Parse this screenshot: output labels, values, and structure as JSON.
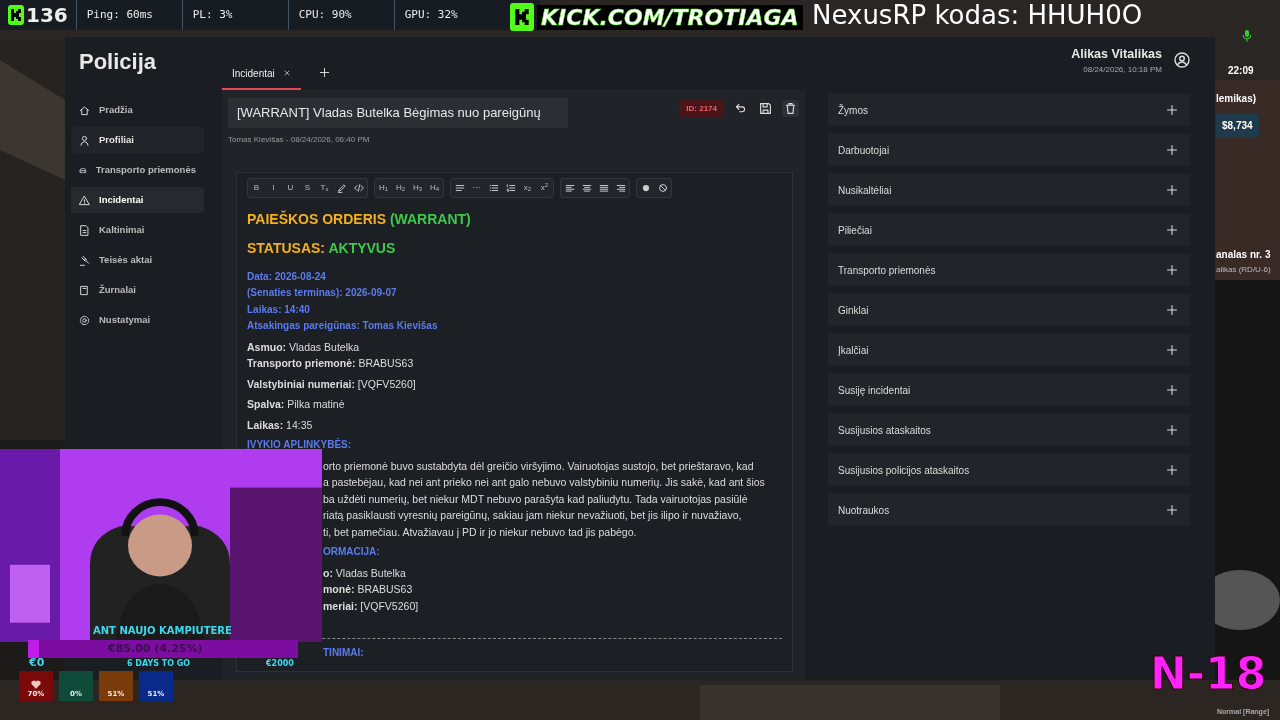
{
  "stream_bar": {
    "viewers": "136",
    "stats": [
      "Ping: 60ms",
      "PL: 3%",
      "CPU: 90%",
      "GPU: 32%"
    ],
    "channel": "KICK.COM/TROTIAGA",
    "promo": "NexusRP kodas: HHUH0O"
  },
  "app": {
    "title": "Policija",
    "user": {
      "name": "Alikas Vitalikas",
      "datetime": "08/24/2026, 10:18 PM"
    },
    "nav": [
      {
        "label": "Pradžia",
        "selected": false,
        "hovered": false
      },
      {
        "label": "Profiliai",
        "selected": false,
        "hovered": true
      },
      {
        "label": "Transporto priemonės",
        "selected": false,
        "hovered": false
      },
      {
        "label": "Incidentai",
        "selected": true,
        "hovered": false
      },
      {
        "label": "Kaltinimai",
        "selected": false,
        "hovered": false
      },
      {
        "label": "Teisės aktai",
        "selected": false,
        "hovered": false
      },
      {
        "label": "Žurnalai",
        "selected": false,
        "hovered": false
      },
      {
        "label": "Nustatymai",
        "selected": false,
        "hovered": false
      }
    ],
    "tabs": [
      {
        "label": "Incidentai",
        "selected": true
      }
    ],
    "incident": {
      "title": "[WARRANT] Vladas Butelka Bėgimas nuo pareigūnų",
      "meta": "Tomas Kievišas - 08/24/2026, 06:40 PM",
      "id": "ID: 2174"
    },
    "toolbar": [
      [
        {
          "kind": "text",
          "label": "B"
        },
        {
          "kind": "text",
          "label": "I"
        },
        {
          "kind": "text",
          "label": "U"
        },
        {
          "kind": "text",
          "label": "S"
        },
        {
          "kind": "text",
          "label": "T$_{x}$"
        },
        {
          "kind": "highlight"
        },
        {
          "kind": "code"
        }
      ],
      [
        {
          "kind": "text",
          "label": "H$_{1}$"
        },
        {
          "kind": "text",
          "label": "H$_{2}$"
        },
        {
          "kind": "text",
          "label": "H$_{3}$"
        },
        {
          "kind": "text",
          "label": "H$_{4}$"
        }
      ],
      [
        {
          "kind": "paragraph"
        },
        {
          "kind": "text",
          "label": "···"
        },
        {
          "kind": "bullets"
        },
        {
          "kind": "numbers"
        },
        {
          "kind": "text",
          "label": "x$_{2}$"
        },
        {
          "kind": "text",
          "label": "x$^{2}$"
        }
      ],
      [
        {
          "kind": "align-left"
        },
        {
          "kind": "align-center"
        },
        {
          "kind": "align-justify"
        },
        {
          "kind": "align-right"
        }
      ],
      [
        {
          "kind": "dot"
        },
        {
          "kind": "clear"
        }
      ]
    ],
    "document": [
      {
        "kind": "heading",
        "parts": [
          {
            "text": "PAIEŠKOS ORDERIS",
            "color": "#f5b01f"
          },
          {
            "text": "(WARRANT)",
            "color": "#3ec94b"
          }
        ]
      },
      {
        "kind": "heading",
        "parts": [
          {
            "text": "STATUSAS:",
            "color": "#f5b01f"
          },
          {
            "text": "AKTYVUS",
            "color": "#3ec94b"
          }
        ]
      },
      {
        "kind": "info",
        "lines": [
          "Data: 2026-08-24",
          "(Senaties terminas): 2026-09-07",
          "Laikas: 14:40",
          "Atsakingas pareigūnas: Tomas Kievišas"
        ]
      },
      {
        "kind": "lines",
        "lines": [
          "**Asmuo:** Vladas Butelka",
          "**Transporto priemonė:** BRABUS63"
        ]
      },
      {
        "kind": "lines",
        "lines": [
          "**Valstybiniai numeriai:** [VQFV5260]"
        ]
      },
      {
        "kind": "lines",
        "lines": [
          "**Spalva:** Pilka matinė"
        ]
      },
      {
        "kind": "lines",
        "lines": [
          "**Laikas:** 14:35"
        ]
      },
      {
        "kind": "info",
        "lines": [
          "ĮVYKIO APLINKYBĖS:"
        ]
      },
      {
        "kind": "partial",
        "lines": [
          "orto priemonė buvo sustabdyta dėl greičio viršyjimo. Vairuotojas sustojo, bet prieštaravo, kad",
          "a pastebėjau, kad nei ant prieko nei ant galo nebuvo valstybiniu numerių. Jis sakė, kad ant šios",
          "ba uždėti numerių, bet niekur MDT nebuvo parašyta kad paliudytu. Tada vairuotojas pasiūlė",
          "riatą pasiklausti vyresnių pareigūnų, sakiau jam niekur nevažiuoti, bet jis ilipo ir nuvažiavo,",
          "ti, bet pamečiau. Atvažiavau į PD ir jo niekur nebuvo tad jis pabėgo."
        ]
      },
      {
        "kind": "partial-info",
        "lines": [
          "ORMACIJA:"
        ]
      },
      {
        "kind": "partial",
        "lines": [
          "**o:** Vladas Butelka",
          "**monė:** BRABUS63",
          "**meriai:** [VQFV5260]"
        ]
      },
      {
        "kind": "rule"
      },
      {
        "kind": "partial-info",
        "lines": [
          "TINIMAI:"
        ]
      }
    ],
    "sections": [
      "Žymos",
      "Darbuotojai",
      "Nusikaltėliai",
      "Piliečiai",
      "Transporto priemonės",
      "Ginklai",
      "Įkalčiai",
      "Susiję incidentai",
      "Susijusios ataskaitos",
      "Susijusios policijos ataskaitos",
      "Nuotraukos"
    ]
  },
  "hud": {
    "clock": "22:09",
    "job": "lemikas)",
    "cash": "$8,734",
    "radio_channel": "analas nr. 3",
    "radio_user": "alikas (RD/U-6)",
    "mode": "Normal [Range]"
  },
  "overlay": {
    "age_mark": "N-18",
    "goal": {
      "title": "ANT NAUJO KAMPIUTERE",
      "amount": "€85.00 (4.25%)",
      "level": 0.0425,
      "start": "€0",
      "days": "6 DAYS TO GO",
      "target": "€2000"
    },
    "status": [
      {
        "value": "70%",
        "color": "#7a0a0a",
        "kind": "health"
      },
      {
        "value": "0%",
        "color": "#0f4a38",
        "kind": "stat"
      },
      {
        "value": "51%",
        "color": "#7a3a0a",
        "kind": "stat"
      },
      {
        "value": "51%",
        "color": "#0a2a8a",
        "kind": "stat"
      }
    ]
  }
}
